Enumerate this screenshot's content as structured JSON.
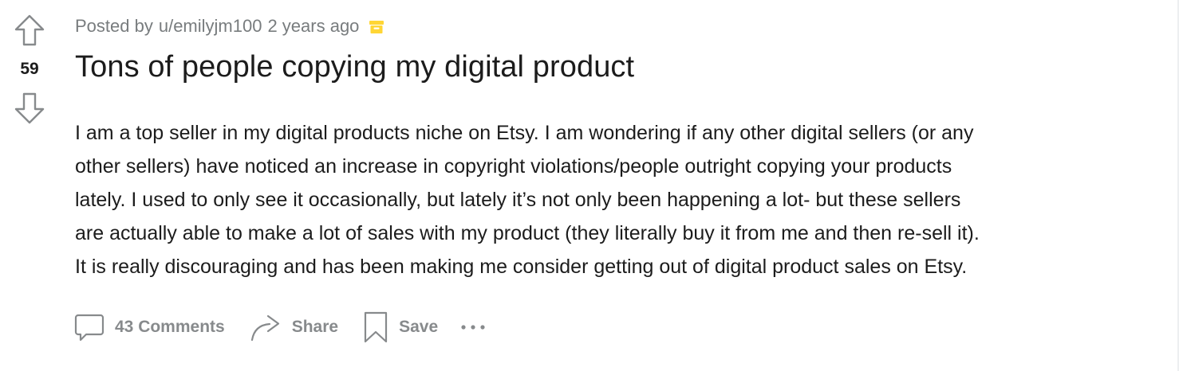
{
  "post": {
    "score": "59",
    "meta": {
      "posted_by_prefix": "Posted by",
      "author": "u/emilyjm100",
      "age": "2 years ago",
      "archive_icon": "archive-icon"
    },
    "title": "Tons of people copying my digital product",
    "body_lines": [
      "I am a top seller in my digital products niche on Etsy. I am wondering if any other digital sellers (or any",
      "other sellers) have noticed an increase in copyright violations/people outright copying your products",
      "lately. I used to only see it occasionally, but lately it’s not only been happening a lot- but these sellers",
      "are actually able to make a lot of sales with my product (they literally buy it from me and then re-sell it).",
      "It is really discouraging and has been making me consider getting out of digital product sales on Etsy."
    ],
    "actions": {
      "comments_label": "43 Comments",
      "share_label": "Share",
      "save_label": "Save"
    }
  },
  "colors": {
    "text": "#1c1c1c",
    "meta": "#787c7e",
    "action": "#878a8c",
    "archive": "#ffd635"
  },
  "icons": [
    "upvote-arrow-icon",
    "downvote-arrow-icon",
    "archive-icon",
    "comment-icon",
    "share-icon",
    "save-bookmark-icon",
    "more-options-icon"
  ]
}
